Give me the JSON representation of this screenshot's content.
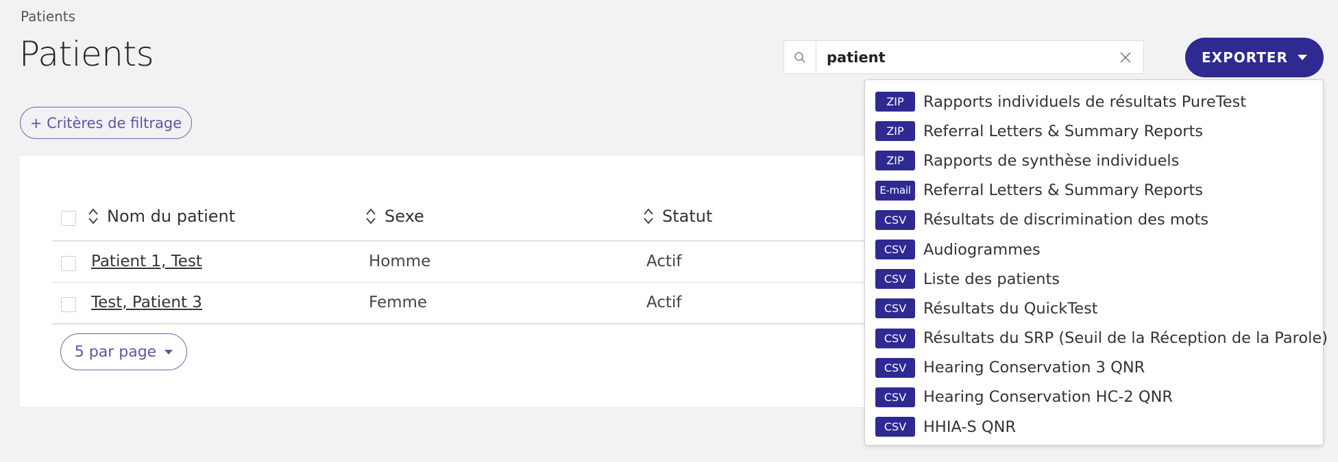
{
  "breadcrumb": "Patients",
  "page_title": "Patients",
  "filter_button": "+ Critères de filtrage",
  "search": {
    "value": "patient",
    "placeholder": ""
  },
  "export_button": "EXPORTER",
  "table": {
    "headers": [
      "Nom du patient",
      "Sexe",
      "Statut"
    ],
    "rows": [
      {
        "name": "Patient 1, Test",
        "sex": "Homme",
        "status": "Actif"
      },
      {
        "name": "Test, Patient 3",
        "sex": "Femme",
        "status": "Actif"
      }
    ]
  },
  "per_page": "5 par page",
  "export_menu": [
    {
      "badge": "ZIP",
      "label": "Rapports individuels de résultats PureTest"
    },
    {
      "badge": "ZIP",
      "label": "Referral Letters & Summary Reports"
    },
    {
      "badge": "ZIP",
      "label": "Rapports de synthèse individuels"
    },
    {
      "badge": "E-mail",
      "label": "Referral Letters & Summary Reports"
    },
    {
      "badge": "CSV",
      "label": "Résultats de discrimination des mots"
    },
    {
      "badge": "CSV",
      "label": "Audiogrammes"
    },
    {
      "badge": "CSV",
      "label": "Liste des patients"
    },
    {
      "badge": "CSV",
      "label": "Résultats du QuickTest"
    },
    {
      "badge": "CSV",
      "label": "Résultats du SRP (Seuil de la Réception de la Parole)"
    },
    {
      "badge": "CSV",
      "label": "Hearing Conservation 3 QNR"
    },
    {
      "badge": "CSV",
      "label": "Hearing Conservation HC-2 QNR"
    },
    {
      "badge": "CSV",
      "label": "HHIA-S QNR"
    }
  ],
  "colors": {
    "accent": "#2e2a92",
    "outline": "#6b64ad",
    "background": "#f2f2f3"
  }
}
